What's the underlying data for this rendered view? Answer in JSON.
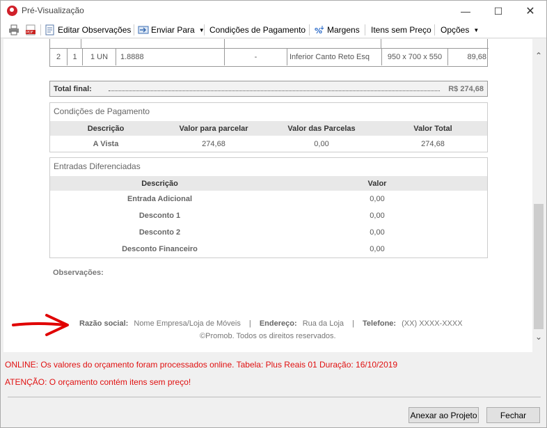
{
  "window": {
    "title": "Pré-Visualização"
  },
  "toolbar": {
    "edit_obs": "Editar Observações",
    "send_to": "Enviar Para",
    "payment_conditions": "Condições de Pagamento",
    "margins": "Margens",
    "items_no_price": "Itens sem Preço",
    "options": "Opções"
  },
  "item_row": {
    "c1": "2",
    "c2": "1",
    "c3": "1 UN",
    "c4": "1.8888",
    "c5": "-",
    "c6": "Inferior Canto Reto Esq",
    "c7": "950 x 700 x 550",
    "c8": "89,68"
  },
  "total": {
    "label": "Total final:",
    "value": "R$ 274,68"
  },
  "payment": {
    "title": "Condições de Pagamento",
    "headers": [
      "Descrição",
      "Valor para parcelar",
      "Valor das Parcelas",
      "Valor Total"
    ],
    "row": [
      "A Vista",
      "274,68",
      "0,00",
      "274,68"
    ]
  },
  "entries": {
    "title": "Entradas Diferenciadas",
    "headers": [
      "Descrição",
      "Valor"
    ],
    "rows": [
      [
        "Entrada Adicional",
        "0,00"
      ],
      [
        "Desconto 1",
        "0,00"
      ],
      [
        "Desconto 2",
        "0,00"
      ],
      [
        "Desconto Financeiro",
        "0,00"
      ]
    ]
  },
  "observations": {
    "label": "Observações:"
  },
  "company": {
    "razao_label": "Razão social:",
    "razao_value": "Nome Empresa/Loja de Móveis",
    "endereco_label": "Endereço:",
    "endereco_value": "Rua da Loja",
    "telefone_label": "Telefone:",
    "telefone_value": "(XX) XXXX-XXXX",
    "copyright": "©Promob. Todos os direitos reservados."
  },
  "status": {
    "online": "ONLINE: Os valores do orçamento foram processados online. Tabela:  Plus Reais 01 Duração: 16/10/2019",
    "warning": "ATENÇÃO: O orçamento contém itens sem preço!"
  },
  "buttons": {
    "attach": "Anexar ao Projeto",
    "close": "Fechar"
  },
  "colors": {
    "status_red": "#e01010",
    "arrow_red": "#e00000"
  }
}
